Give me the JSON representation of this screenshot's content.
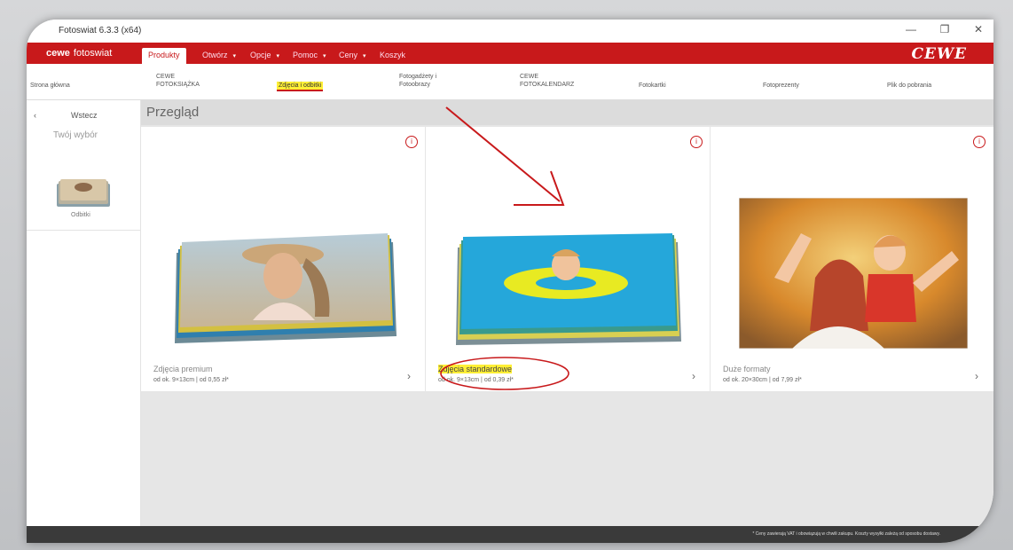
{
  "window": {
    "title": "Fotoswiat 6.3.3 (x64)",
    "controls": [
      "—",
      "❐",
      "✕"
    ]
  },
  "menubar": {
    "brand_strong": "cewe",
    "brand_rest": "fotoswiat",
    "tabs": [
      {
        "label": "Produkty",
        "active": true
      },
      {
        "label": "Otwórz",
        "active": false
      },
      {
        "label": "Opcje",
        "active": false
      },
      {
        "label": "Pomoc",
        "active": false
      },
      {
        "label": "Ceny",
        "active": false
      },
      {
        "label": "Koszyk",
        "active": false
      }
    ],
    "logo": "CEWE"
  },
  "subnav": {
    "items": [
      {
        "label": "Strona główna"
      },
      {
        "label": "CEWE FOTOKSIĄŻKA"
      },
      {
        "label": "Zdjęcia i odbitki",
        "highlight": true
      },
      {
        "label": "Fotogadżety i Fotoobrazy"
      },
      {
        "label": "CEWE FOTOKALENDARZ"
      },
      {
        "label": "Fotokartki"
      },
      {
        "label": "Fotoprezenty"
      },
      {
        "label": "Plik do pobrania"
      }
    ]
  },
  "sidebar": {
    "back_label": "Wstecz",
    "your_selection": "Twój wybór",
    "thumb_label": "Odbitki"
  },
  "main": {
    "title": "Przegląd",
    "cards": [
      {
        "name": "Zdjęcia premium",
        "price": "od ok. 9×13cm | od 0,55 zł*",
        "highlight": false
      },
      {
        "name": "Zdjęcia standardowe",
        "price": "od ok. 9×13cm | od 0,39 zł*",
        "highlight": true
      },
      {
        "name": "Duże formaty",
        "price": "od ok. 20×30cm | od 7,99 zł*",
        "highlight": false
      }
    ]
  },
  "footer": {
    "note": "* Ceny zawierają VAT i obowiązują w chwili zakupu. Koszty wysyłki zależą od sposobu dostawy."
  },
  "colors": {
    "brand_red": "#c8191b",
    "highlight_yellow": "#ffef35"
  }
}
